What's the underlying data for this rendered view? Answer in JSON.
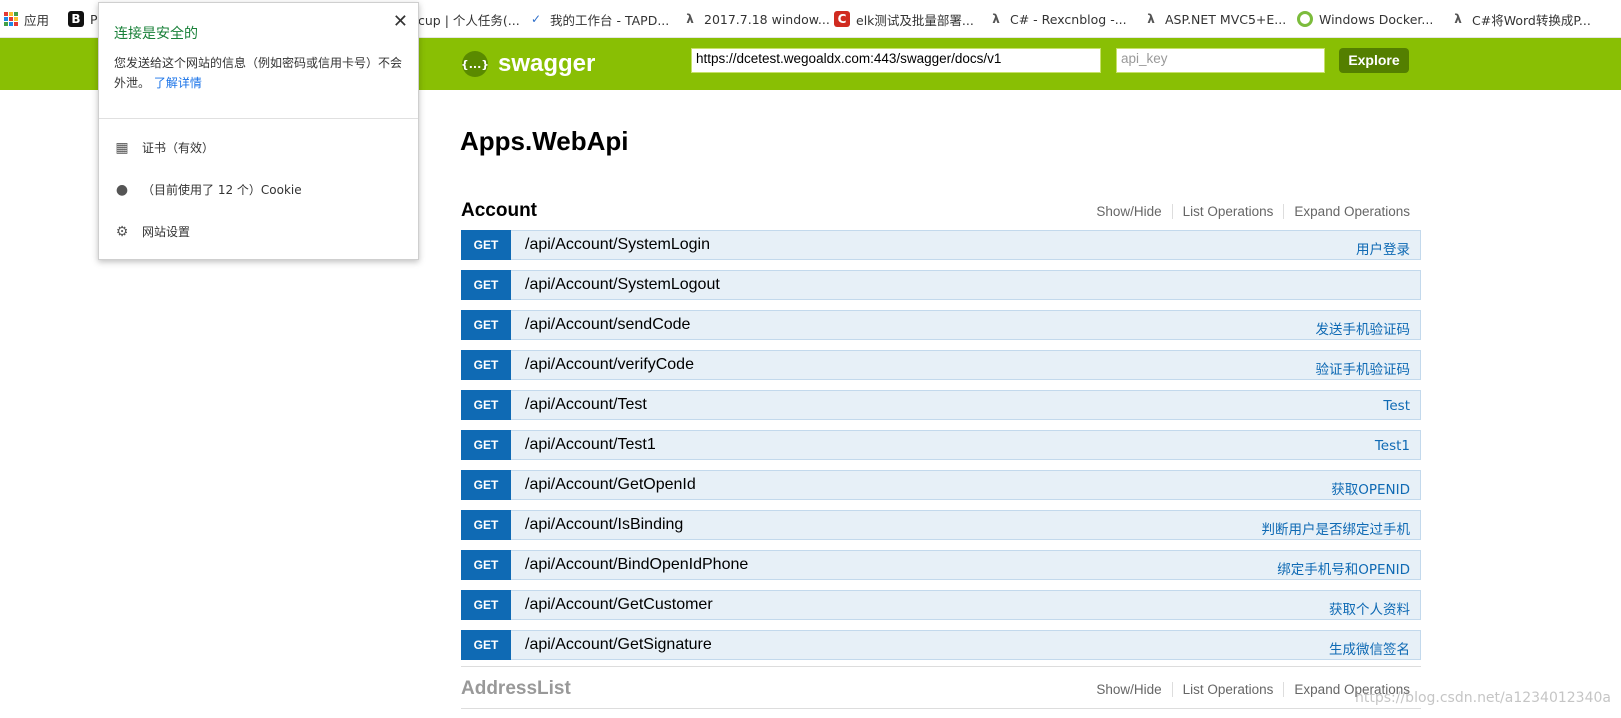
{
  "bookmarks": {
    "apps_label": "应用",
    "items": [
      {
        "label": "P",
        "icon": "b-icon"
      },
      {
        "label": "cup | 个人任务(...",
        "icon": "none"
      },
      {
        "label": "我的工作台 - TAPD...",
        "icon": "tapd-icon"
      },
      {
        "label": "2017.7.18 window...",
        "icon": "lambda-icon"
      },
      {
        "label": "elk测试及批量部署...",
        "icon": "csdn-c-icon"
      },
      {
        "label": "C# - Rexcnblog -...",
        "icon": "lambda-icon"
      },
      {
        "label": "ASP.NET MVC5+E...",
        "icon": "lambda-icon"
      },
      {
        "label": "Windows Docker...",
        "icon": "circle-icon"
      },
      {
        "label": "C#将Word转换成P...",
        "icon": "lambda-icon"
      }
    ]
  },
  "header": {
    "logo_symbol": "{...}",
    "logo_text": "swagger",
    "url_value": "https://dcetest.wegoaldx.com:443/swagger/docs/v1",
    "api_key_placeholder": "api_key",
    "explore_label": "Explore",
    "color": "#89bf04"
  },
  "main": {
    "title": "Apps.WebApi",
    "resources": [
      {
        "name": "Account",
        "links": [
          "Show/Hide",
          "List Operations",
          "Expand Operations"
        ],
        "operations": [
          {
            "method": "GET",
            "path": "/api/Account/SystemLogin",
            "summary": "用户登录"
          },
          {
            "method": "GET",
            "path": "/api/Account/SystemLogout",
            "summary": ""
          },
          {
            "method": "GET",
            "path": "/api/Account/sendCode",
            "summary": "发送手机验证码"
          },
          {
            "method": "GET",
            "path": "/api/Account/verifyCode",
            "summary": "验证手机验证码"
          },
          {
            "method": "GET",
            "path": "/api/Account/Test",
            "summary": "Test"
          },
          {
            "method": "GET",
            "path": "/api/Account/Test1",
            "summary": "Test1"
          },
          {
            "method": "GET",
            "path": "/api/Account/GetOpenId",
            "summary": "获取OPENID"
          },
          {
            "method": "GET",
            "path": "/api/Account/IsBinding",
            "summary": "判断用户是否绑定过手机"
          },
          {
            "method": "GET",
            "path": "/api/Account/BindOpenIdPhone",
            "summary": "绑定手机号和OPENID"
          },
          {
            "method": "GET",
            "path": "/api/Account/GetCustomer",
            "summary": "获取个人资料"
          },
          {
            "method": "GET",
            "path": "/api/Account/GetSignature",
            "summary": "生成微信签名"
          }
        ]
      },
      {
        "name": "AddressList",
        "links": [
          "Show/Hide",
          "List Operations",
          "Expand Operations"
        ],
        "operations": []
      }
    ]
  },
  "popup": {
    "title": "连接是安全的",
    "close": "✕",
    "text": "您发送给这个网站的信息（例如密码或信用卡号）不会外泄。",
    "link": "了解详情",
    "rows": [
      {
        "label": "证书（有效）",
        "icon": "certificate-icon"
      },
      {
        "label": "（目前使用了 12 个）Cookie",
        "icon": "cookie-icon"
      },
      {
        "label": "网站设置",
        "icon": "gear-icon"
      }
    ]
  },
  "watermark": "https://blog.csdn.net/a1234012340a"
}
